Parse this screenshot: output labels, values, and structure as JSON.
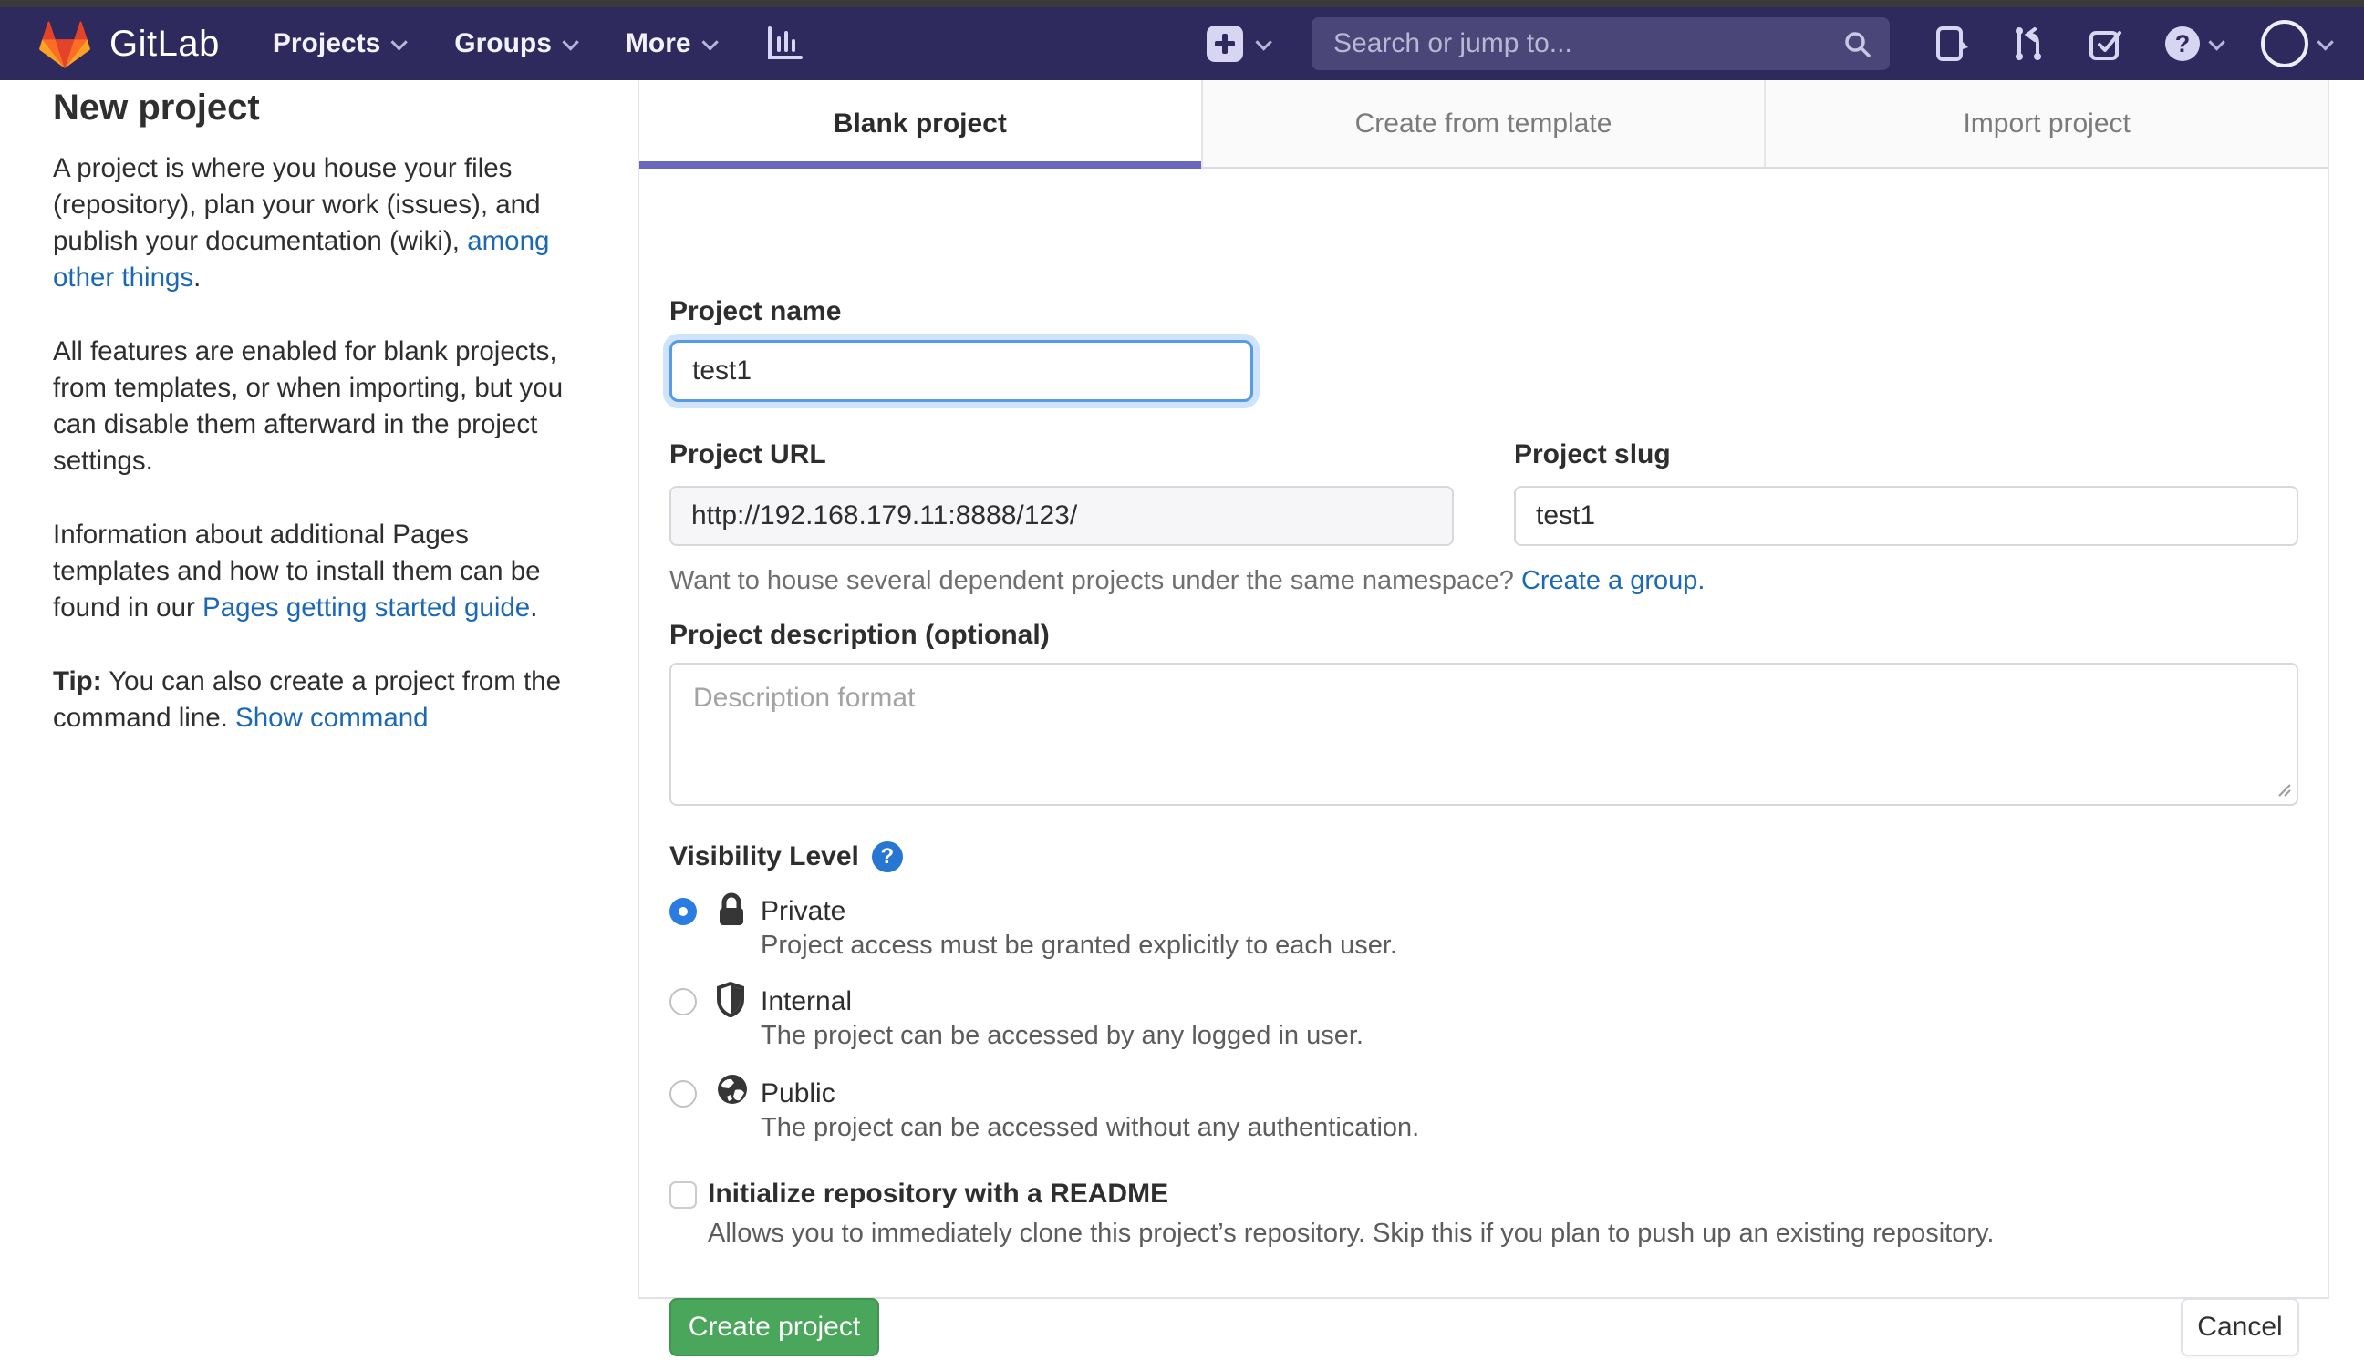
{
  "navbar": {
    "logo_text": "GitLab",
    "menu": [
      {
        "label": "Projects"
      },
      {
        "label": "Groups"
      },
      {
        "label": "More"
      }
    ],
    "search": {
      "placeholder": "Search or jump to..."
    }
  },
  "sidebar": {
    "title": "New project",
    "p1": {
      "text": "A project is where you house your files (repository), plan your work (issues), and publish your documentation (wiki), ",
      "link": "among other things",
      "after": "."
    },
    "p2": "All features are enabled for blank projects, from templates, or when importing, but you can disable them afterward in the project settings.",
    "p3": {
      "text": "Information about additional Pages templates and how to install them can be found in our ",
      "link": "Pages getting started guide",
      "after": "."
    },
    "tip": {
      "bold": "Tip:",
      "text": " You can also create a project from the command line. ",
      "link": "Show command"
    }
  },
  "tabs": [
    {
      "label": "Blank project"
    },
    {
      "label": "Create from template"
    },
    {
      "label": "Import project"
    }
  ],
  "form": {
    "project_name": {
      "label": "Project name",
      "value": "test1"
    },
    "project_url": {
      "label": "Project URL",
      "value": "http://192.168.179.11:8888/123/"
    },
    "project_slug": {
      "label": "Project slug",
      "value": "test1"
    },
    "namespace_hint": {
      "text": "Want to house several dependent projects under the same namespace? ",
      "link": "Create a group."
    },
    "description": {
      "label": "Project description (optional)",
      "placeholder": "Description format"
    },
    "visibility": {
      "label": "Visibility Level",
      "help_glyph": "?",
      "options": [
        {
          "name": "Private",
          "description": "Project access must be granted explicitly to each user."
        },
        {
          "name": "Internal",
          "description": "The project can be accessed by any logged in user."
        },
        {
          "name": "Public",
          "description": "The project can be accessed without any authentication."
        }
      ]
    },
    "readme": {
      "label": "Initialize repository with a README",
      "description": "Allows you to immediately clone this project’s repository. Skip this if you plan to push up an existing repository."
    },
    "submit_label": "Create project",
    "cancel_label": "Cancel"
  },
  "colors": {
    "navbar_bg": "#2e2a5e",
    "tab_accent": "#6a67bf",
    "link": "#1b69b6",
    "primary_button": "#49a65b",
    "radio_selected": "#2b7ce2",
    "help_badge": "#2776d2"
  }
}
